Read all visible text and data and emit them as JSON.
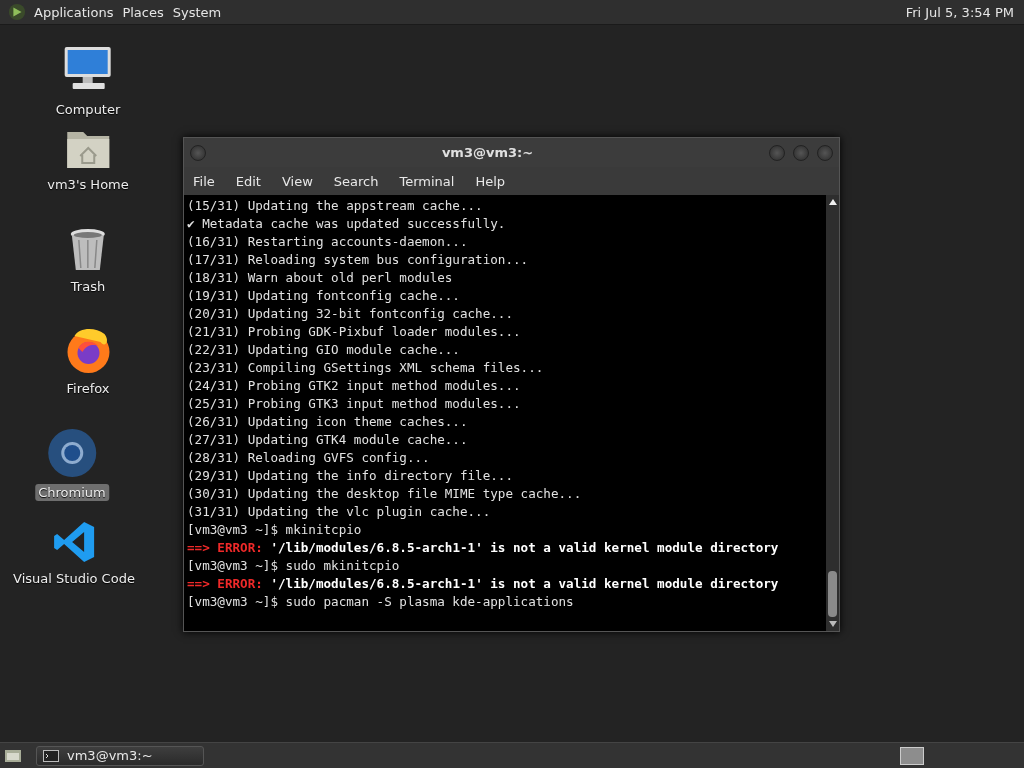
{
  "top_panel": {
    "menus": [
      "Applications",
      "Places",
      "System"
    ],
    "clock": "Fri Jul 5, 3:54 PM"
  },
  "desktop_icons": [
    {
      "kind": "computer",
      "label": "Computer",
      "selected": false
    },
    {
      "kind": "home",
      "label": "vm3's Home",
      "selected": false
    },
    {
      "kind": "trash",
      "label": "Trash",
      "selected": false
    },
    {
      "kind": "firefox",
      "label": "Firefox",
      "selected": false
    },
    {
      "kind": "chromium",
      "label": "Chromium",
      "selected": true
    },
    {
      "kind": "vscode",
      "label": "Visual Studio Code",
      "selected": false
    }
  ],
  "terminal": {
    "title": "vm3@vm3:~",
    "menu": [
      "File",
      "Edit",
      "View",
      "Search",
      "Terminal",
      "Help"
    ],
    "lines": [
      {
        "kind": "output",
        "text": "(15/31) Updating the appstream cache..."
      },
      {
        "kind": "output",
        "text": "✔ Metadata cache was updated successfully."
      },
      {
        "kind": "output",
        "text": "(16/31) Restarting accounts-daemon..."
      },
      {
        "kind": "output",
        "text": "(17/31) Reloading system bus configuration..."
      },
      {
        "kind": "output",
        "text": "(18/31) Warn about old perl modules"
      },
      {
        "kind": "output",
        "text": "(19/31) Updating fontconfig cache..."
      },
      {
        "kind": "output",
        "text": "(20/31) Updating 32-bit fontconfig cache..."
      },
      {
        "kind": "output",
        "text": "(21/31) Probing GDK-Pixbuf loader modules..."
      },
      {
        "kind": "output",
        "text": "(22/31) Updating GIO module cache..."
      },
      {
        "kind": "output",
        "text": "(23/31) Compiling GSettings XML schema files..."
      },
      {
        "kind": "output",
        "text": "(24/31) Probing GTK2 input method modules..."
      },
      {
        "kind": "output",
        "text": "(25/31) Probing GTK3 input method modules..."
      },
      {
        "kind": "output",
        "text": "(26/31) Updating icon theme caches..."
      },
      {
        "kind": "output",
        "text": "(27/31) Updating GTK4 module cache..."
      },
      {
        "kind": "output",
        "text": "(28/31) Reloading GVFS config..."
      },
      {
        "kind": "output",
        "text": "(29/31) Updating the info directory file..."
      },
      {
        "kind": "output",
        "text": "(30/31) Updating the desktop file MIME type cache..."
      },
      {
        "kind": "output",
        "text": "(31/31) Updating the vlc plugin cache..."
      },
      {
        "kind": "prompt",
        "prompt": "[vm3@vm3 ~]$",
        "command": "mkinitcpio"
      },
      {
        "kind": "error",
        "arrow": "==>",
        "label": "ERROR:",
        "message": "'/lib/modules/6.8.5-arch1-1' is not a valid kernel module directory"
      },
      {
        "kind": "prompt",
        "prompt": "[vm3@vm3 ~]$",
        "command": "sudo mkinitcpio"
      },
      {
        "kind": "error",
        "arrow": "==>",
        "label": "ERROR:",
        "message": "'/lib/modules/6.8.5-arch1-1' is not a valid kernel module directory"
      },
      {
        "kind": "prompt",
        "prompt": "[vm3@vm3 ~]$",
        "command": "sudo pacman -S plasma kde-applications"
      }
    ]
  },
  "taskbar": {
    "tasks": [
      {
        "title": "vm3@vm3:~",
        "selected": false
      }
    ]
  }
}
